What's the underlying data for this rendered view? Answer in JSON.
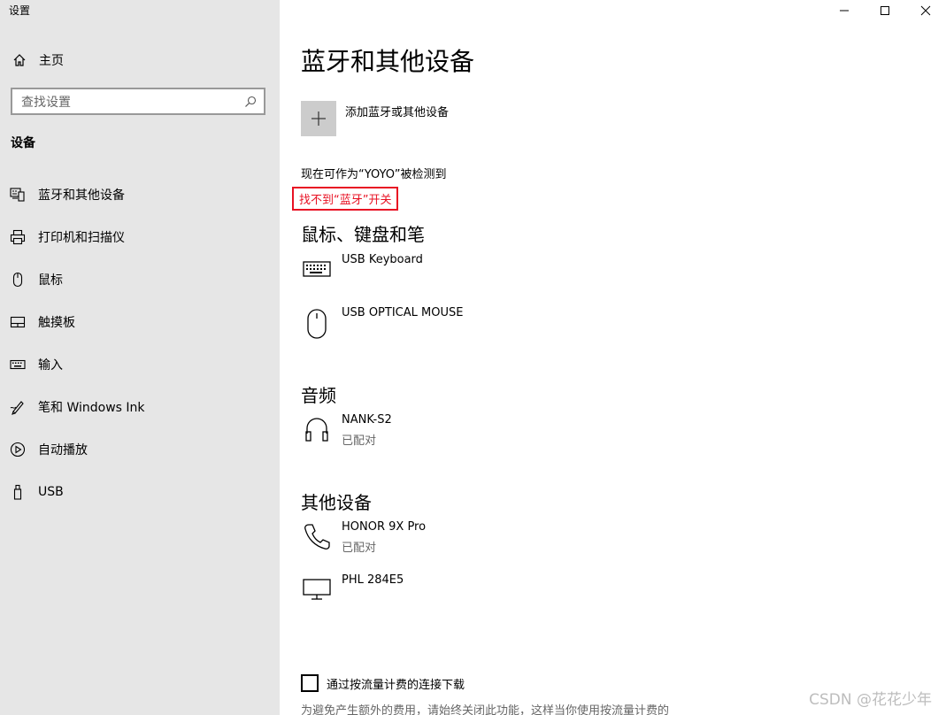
{
  "app": {
    "title": "设置"
  },
  "sidebar": {
    "home_label": "主页",
    "search_placeholder": "查找设置",
    "section_title": "设备",
    "items": [
      {
        "label": "蓝牙和其他设备",
        "icon": "bluetooth-devices-icon"
      },
      {
        "label": "打印机和扫描仪",
        "icon": "printer-icon"
      },
      {
        "label": "鼠标",
        "icon": "mouse-icon"
      },
      {
        "label": "触摸板",
        "icon": "touchpad-icon"
      },
      {
        "label": "输入",
        "icon": "keyboard-icon"
      },
      {
        "label": "笔和 Windows Ink",
        "icon": "pen-icon"
      },
      {
        "label": "自动播放",
        "icon": "autoplay-icon"
      },
      {
        "label": "USB",
        "icon": "usb-icon"
      }
    ]
  },
  "main": {
    "title": "蓝牙和其他设备",
    "add_device_label": "添加蓝牙或其他设备",
    "discoverable_text": "现在可作为“YOYO”被检测到",
    "cant_find_text": "找不到“蓝牙”开关",
    "groups": {
      "input": {
        "title": "鼠标、键盘和笔",
        "devices": [
          {
            "name": "USB Keyboard",
            "icon": "keyboard-icon"
          },
          {
            "name": "USB OPTICAL MOUSE",
            "icon": "mouse-icon"
          }
        ]
      },
      "audio": {
        "title": "音频",
        "devices": [
          {
            "name": "NANK-S2",
            "status": "已配对",
            "icon": "headphones-icon"
          }
        ]
      },
      "other": {
        "title": "其他设备",
        "devices": [
          {
            "name": "HONOR 9X Pro",
            "status": "已配对",
            "icon": "phone-icon"
          },
          {
            "name": "PHL 284E5",
            "icon": "monitor-icon"
          }
        ]
      }
    },
    "metered": {
      "label": "通过按流量计费的连接下载",
      "checked": false,
      "description": "为避免产生额外的费用，请始终关闭此功能，这样当你使用按流量计费的"
    }
  },
  "watermark": "CSDN @花花少年",
  "colors": {
    "sidebar_bg": "#e6e6e6",
    "error_red": "#e81123",
    "tile_gray": "#cccccc"
  }
}
